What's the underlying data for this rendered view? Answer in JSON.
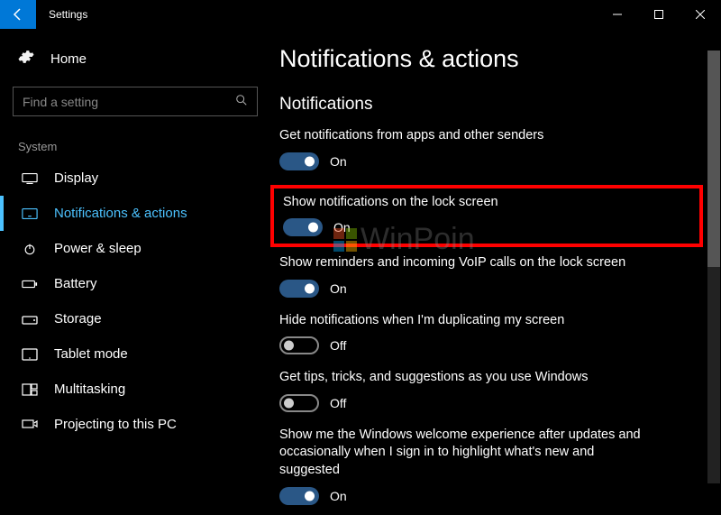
{
  "window": {
    "title": "Settings",
    "home": "Home",
    "search_placeholder": "Find a setting"
  },
  "sidebar": {
    "group": "System",
    "items": [
      {
        "label": "Display"
      },
      {
        "label": "Notifications & actions"
      },
      {
        "label": "Power & sleep"
      },
      {
        "label": "Battery"
      },
      {
        "label": "Storage"
      },
      {
        "label": "Tablet mode"
      },
      {
        "label": "Multitasking"
      },
      {
        "label": "Projecting to this PC"
      }
    ]
  },
  "main": {
    "title": "Notifications & actions",
    "section": "Notifications",
    "settings": [
      {
        "label": "Get notifications from apps and other senders",
        "state": "On",
        "on": true
      },
      {
        "label": "Show notifications on the lock screen",
        "state": "On",
        "on": true
      },
      {
        "label": "Show reminders and incoming VoIP calls on the lock screen",
        "state": "On",
        "on": true
      },
      {
        "label": "Hide notifications when I'm duplicating my screen",
        "state": "Off",
        "on": false
      },
      {
        "label": "Get tips, tricks, and suggestions as you use Windows",
        "state": "Off",
        "on": false
      },
      {
        "label": "Show me the Windows welcome experience after updates and occasionally when I sign in to highlight what's new and suggested",
        "state": "On",
        "on": true
      }
    ]
  },
  "watermark": "WinPoin"
}
